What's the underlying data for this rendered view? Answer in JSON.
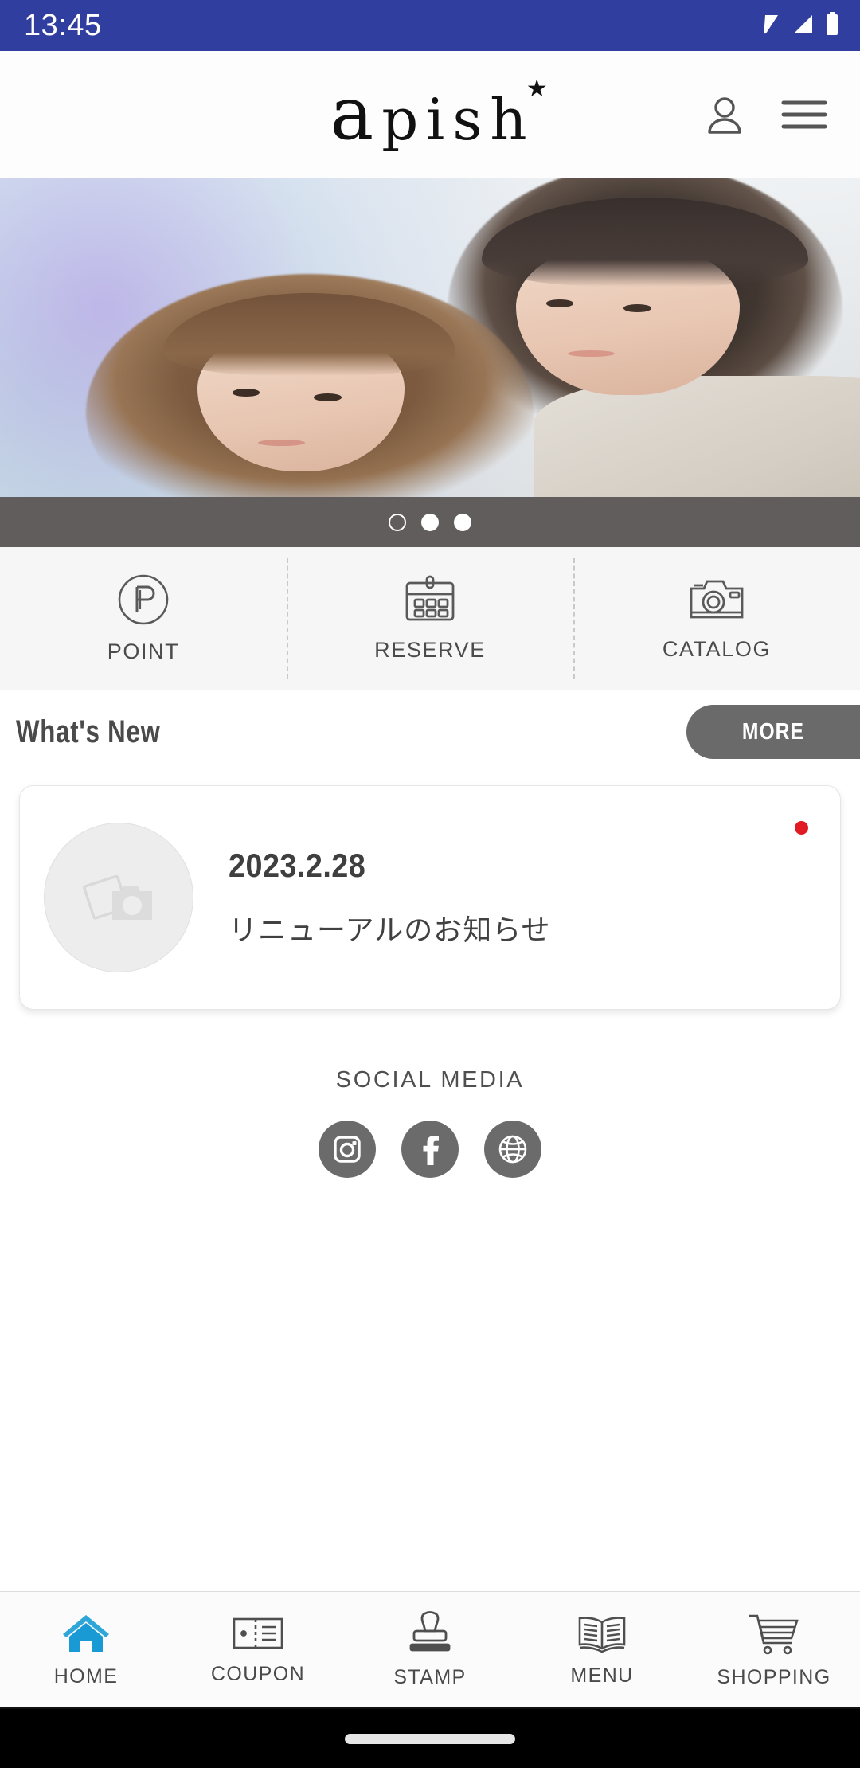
{
  "statusbar": {
    "time": "13:45",
    "icons": [
      "wifi-icon",
      "cellular-signal-icon",
      "battery-icon"
    ]
  },
  "header": {
    "logo_a": "a",
    "logo_star": "★",
    "logo_rest": "pish",
    "logo_full": "apish",
    "account_icon": "user-icon",
    "menu_icon": "hamburger-menu-icon"
  },
  "hero": {
    "alt": "two women with styled hair",
    "carousel": {
      "total": 3,
      "active_index": 0,
      "dots": [
        "hollow",
        "filled",
        "filled"
      ]
    }
  },
  "quick_actions": [
    {
      "label": "POINT",
      "icon": "circled-p-icon"
    },
    {
      "label": "RESERVE",
      "icon": "calendar-icon"
    },
    {
      "label": "CATALOG",
      "icon": "camera-icon"
    }
  ],
  "news_section": {
    "title": "What's New",
    "more_label": "MORE",
    "items": [
      {
        "date": "2023.2.28",
        "title": "リニューアルのお知らせ",
        "thumb_icon": "photo-placeholder-icon",
        "unread": true
      }
    ]
  },
  "social": {
    "title": "SOCIAL MEDIA",
    "links": [
      {
        "name": "instagram",
        "icon": "instagram-icon"
      },
      {
        "name": "facebook",
        "icon": "facebook-icon"
      },
      {
        "name": "website",
        "icon": "globe-icon"
      }
    ]
  },
  "bottom_nav": {
    "active": "HOME",
    "items": [
      {
        "label": "HOME",
        "icon": "home-icon"
      },
      {
        "label": "COUPON",
        "icon": "ticket-icon"
      },
      {
        "label": "STAMP",
        "icon": "stamp-icon"
      },
      {
        "label": "MENU",
        "icon": "book-icon"
      },
      {
        "label": "SHOPPING",
        "icon": "cart-icon"
      }
    ]
  },
  "colors": {
    "statusbar_bg": "#303F9F",
    "dots_strip_bg": "#615d5d",
    "quick_bg": "#f6f6f6",
    "more_btn_bg": "#6a6a6a",
    "badge_red": "#e01b23",
    "social_circle": "#6b6b6b",
    "nav_active": "#1a9ad4",
    "nav_inactive": "#4a4a4a",
    "gesture_bar_bg": "#000000"
  }
}
